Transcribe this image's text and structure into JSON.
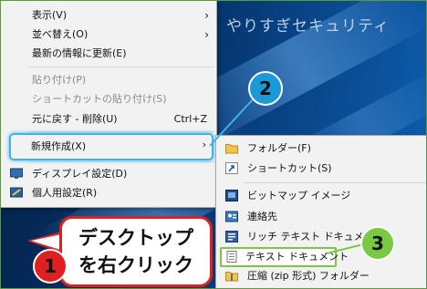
{
  "desktop": {
    "overlay_title": "やりすぎセキュリティ"
  },
  "context_menu": {
    "items": [
      {
        "label": "表示(V)",
        "submenu": true,
        "disabled": false
      },
      {
        "label": "並べ替え(O)",
        "submenu": true,
        "disabled": false
      },
      {
        "label": "最新の情報に更新(E)",
        "disabled": false
      },
      {
        "label": "貼り付け(P)",
        "disabled": true
      },
      {
        "label": "ショートカットの貼り付け(S)",
        "disabled": true
      },
      {
        "label": "元に戻す - 削除(U)",
        "shortcut": "Ctrl+Z",
        "disabled": false
      },
      {
        "label": "新規作成(X)",
        "submenu": true,
        "highlighted": true
      },
      {
        "label": "ディスプレイ設定(D)",
        "icon": "display-settings-icon"
      },
      {
        "label": "個人用設定(R)",
        "icon": "personalize-icon"
      }
    ]
  },
  "submenu": {
    "items": [
      {
        "label": "フォルダー(F)",
        "icon": "folder-icon"
      },
      {
        "label": "ショートカット(S)",
        "icon": "shortcut-icon"
      },
      {
        "label": "ビットマップ イメージ",
        "icon": "bitmap-icon"
      },
      {
        "label": "連絡先",
        "icon": "contact-icon"
      },
      {
        "label": "リッチ テキスト ドキュメント",
        "icon": "rich-text-icon"
      },
      {
        "label": "テキスト ドキュメント",
        "icon": "text-document-icon",
        "highlighted": true
      },
      {
        "label": "圧縮 (zip 形式) フォルダー",
        "icon": "zip-folder-icon"
      }
    ]
  },
  "annotations": {
    "callout_line1": "デスクトップ",
    "callout_line2": "を右クリック",
    "badge1": "1",
    "badge2": "2",
    "badge3": "3",
    "colors": {
      "badge1": "#e02020",
      "badge2": "#1a9ad8",
      "badge3": "#7ac943",
      "highlight": "#3fb4e8"
    }
  }
}
